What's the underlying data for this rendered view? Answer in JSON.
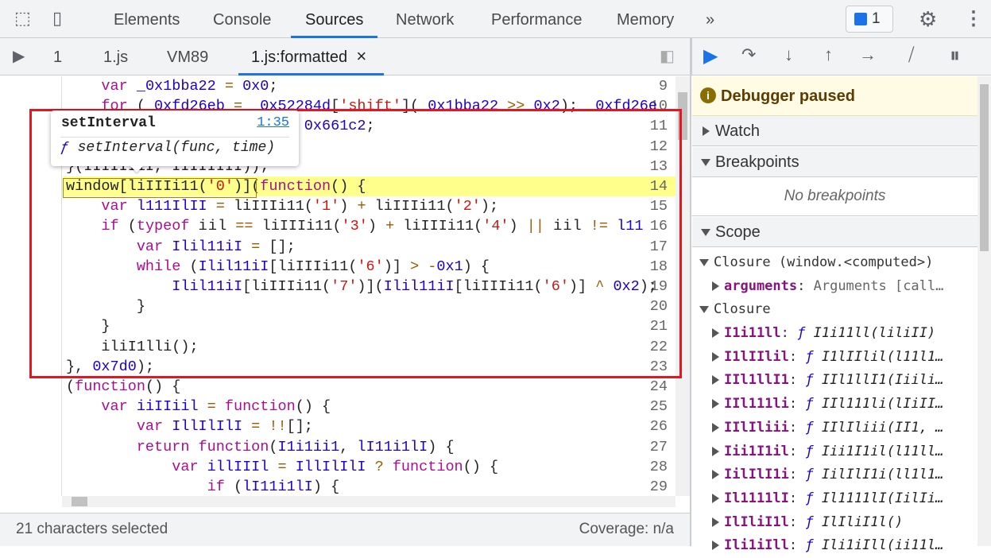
{
  "toolbar": {
    "tabs": [
      "Elements",
      "Console",
      "Sources",
      "Network",
      "Performance",
      "Memory"
    ],
    "active_tab": "Sources",
    "more": "»",
    "issues_count": "1",
    "icons": [
      "inspect-icon",
      "device-toggle-icon",
      "issues-icon",
      "gear-icon",
      "kebab-menu-icon"
    ]
  },
  "files": {
    "tabs": [
      "1",
      "1.js",
      "VM89",
      "1.js:formatted"
    ],
    "active": "1.js:formatted",
    "close": "×"
  },
  "debugger": {
    "paused_label": "Debugger paused",
    "icons": [
      "resume-icon",
      "step-over-icon",
      "step-into-icon",
      "step-out-icon",
      "step-icon",
      "deactivate-breakpoints-icon",
      "pause-on-exceptions-icon"
    ],
    "watch": "Watch",
    "breakpoints": "Breakpoints",
    "no_breakpoints": "No breakpoints",
    "scope": "Scope",
    "closure1": "Closure (window.<computed>)",
    "arguments": {
      "name": "arguments",
      "value": "Arguments [call…"
    },
    "closure2": "Closure",
    "scope_items": [
      {
        "name": "I1i11ll",
        "value": "I1i11ll(liliII)"
      },
      {
        "name": "I1lIIlil",
        "value": "I1lIIlil(l11l1…"
      },
      {
        "name": "IIl1llI1",
        "value": "IIl1llI1(Iiili…"
      },
      {
        "name": "IIl111li",
        "value": "IIl111li(lIiII…"
      },
      {
        "name": "IIlIliii",
        "value": "IIlIliii(II1, …"
      },
      {
        "name": "Iii1I1il",
        "value": "Iii1I1il(l11ll…"
      },
      {
        "name": "IilIlI1i",
        "value": "IilIlI1i(ll1l1…"
      },
      {
        "name": "Il1111lI",
        "value": "Il1111lI(IilIi…"
      },
      {
        "name": "IlIliI1l",
        "value": "IlIliI1l()"
      },
      {
        "name": "Ili1iIll",
        "value": "Ili1iIll(ii11l…"
      }
    ],
    "f": "ƒ"
  },
  "tooltip": {
    "title": "setInterval",
    "location": "1:35",
    "f": "ƒ",
    "signature": "setInterval(func, time)"
  },
  "editor": {
    "first_line": 9,
    "highlight_line": 14,
    "lines": [
      [
        [
          "x",
          "    "
        ],
        [
          "k",
          "var "
        ],
        [
          "v",
          "_0x1bba22"
        ],
        [
          "o",
          " = "
        ],
        [
          "n",
          "0x0"
        ],
        [
          "p",
          ";"
        ]
      ],
      [
        [
          "x",
          "    "
        ],
        [
          "k",
          "for "
        ],
        [
          "p",
          "("
        ],
        [
          "v",
          "_0xfd26eb"
        ],
        [
          "o",
          " = "
        ],
        [
          "v",
          "_0x52284d"
        ],
        [
          "p",
          "["
        ],
        [
          "s",
          "'shift'"
        ],
        [
          "p",
          "]("
        ],
        [
          "v",
          "_0x1bba22"
        ],
        [
          "o",
          " >> "
        ],
        [
          "n",
          "0x2"
        ],
        [
          "p",
          "); "
        ],
        [
          "v",
          "_0xfd26e"
        ]
      ],
      [
        [
          "x",
          "                    "
        ],
        [
          "v",
          "ba22"
        ],
        [
          "o",
          " ^ "
        ],
        [
          "n",
          "0x661c2"
        ],
        [
          "p",
          ";"
        ]
      ],
      [],
      [
        [
          "p",
          "}("
        ],
        [
          "x",
          "IIIIII1I, IIIIIIII"
        ],
        [
          "p",
          "));"
        ]
      ],
      [
        [
          "x",
          "window"
        ],
        [
          "p",
          "["
        ],
        [
          "x",
          "liIIIi11"
        ],
        [
          "p",
          "("
        ],
        [
          "s",
          "'0'"
        ],
        [
          "p",
          ")]("
        ],
        [
          "k",
          "function"
        ],
        [
          "p",
          "() {"
        ]
      ],
      [
        [
          "x",
          "    "
        ],
        [
          "k",
          "var "
        ],
        [
          "v",
          "l111IlII"
        ],
        [
          "o",
          " = "
        ],
        [
          "x",
          "liIIIi11"
        ],
        [
          "p",
          "("
        ],
        [
          "s",
          "'1'"
        ],
        [
          "p",
          ")"
        ],
        [
          "o",
          " + "
        ],
        [
          "x",
          "liIIIi11"
        ],
        [
          "p",
          "("
        ],
        [
          "s",
          "'2'"
        ],
        [
          "p",
          ");"
        ]
      ],
      [
        [
          "x",
          "    "
        ],
        [
          "k",
          "if "
        ],
        [
          "p",
          "("
        ],
        [
          "k",
          "typeof "
        ],
        [
          "x",
          "i i l"
        ],
        [
          "o",
          " == "
        ],
        [
          "x",
          "liIIIi11"
        ],
        [
          "p",
          "("
        ],
        [
          "s",
          "'3'"
        ],
        [
          "p",
          ")"
        ],
        [
          "o",
          " + "
        ],
        [
          "x",
          "liIIIi11"
        ],
        [
          "p",
          "("
        ],
        [
          "s",
          "'4'"
        ],
        [
          "p",
          ")"
        ],
        [
          "o",
          " || "
        ],
        [
          "x",
          "i i l"
        ],
        [
          "o",
          " != "
        ],
        [
          "v",
          "l11"
        ]
      ],
      [
        [
          "x",
          "        "
        ],
        [
          "k",
          "var "
        ],
        [
          "v",
          "Ilil11iI"
        ],
        [
          "o",
          " = "
        ],
        [
          "p",
          "[];"
        ]
      ],
      [
        [
          "x",
          "        "
        ],
        [
          "k",
          "while "
        ],
        [
          "p",
          "("
        ],
        [
          "v",
          "Ilil11iI"
        ],
        [
          "p",
          "["
        ],
        [
          "x",
          "liIIIi11"
        ],
        [
          "p",
          "("
        ],
        [
          "s",
          "'6'"
        ],
        [
          "p",
          ")]"
        ],
        [
          "o",
          " > -"
        ],
        [
          "n",
          "0x1"
        ],
        [
          "p",
          ") {"
        ]
      ],
      [
        [
          "x",
          "            "
        ],
        [
          "v",
          "Ilil11iI"
        ],
        [
          "p",
          "["
        ],
        [
          "x",
          "liIIIi11"
        ],
        [
          "p",
          "("
        ],
        [
          "s",
          "'7'"
        ],
        [
          "p",
          ")]("
        ],
        [
          "v",
          "Ilil11iI"
        ],
        [
          "p",
          "["
        ],
        [
          "x",
          "liIIIi11"
        ],
        [
          "p",
          "("
        ],
        [
          "s",
          "'6'"
        ],
        [
          "p",
          ")]"
        ],
        [
          "o",
          " ^ "
        ],
        [
          "n",
          "0x2"
        ],
        [
          "p",
          ");"
        ]
      ],
      [
        [
          "x",
          "        "
        ],
        [
          "p",
          "}"
        ]
      ],
      [
        [
          "x",
          "    "
        ],
        [
          "p",
          "}"
        ]
      ],
      [
        [
          "x",
          "    iliI1lli"
        ],
        [
          "p",
          "();"
        ]
      ],
      [
        [
          "p",
          "}, "
        ],
        [
          "n",
          "0x7d0"
        ],
        [
          "p",
          ");"
        ]
      ],
      [
        [
          "p",
          "("
        ],
        [
          "k",
          "function"
        ],
        [
          "p",
          "() {"
        ]
      ],
      [
        [
          "x",
          "    "
        ],
        [
          "k",
          "var "
        ],
        [
          "v",
          "iiIIiil"
        ],
        [
          "o",
          " = "
        ],
        [
          "k",
          "function"
        ],
        [
          "p",
          "() {"
        ]
      ],
      [
        [
          "x",
          "        "
        ],
        [
          "k",
          "var "
        ],
        [
          "v",
          "IllIlIlI"
        ],
        [
          "o",
          " = !!"
        ],
        [
          "p",
          "[];"
        ]
      ],
      [
        [
          "x",
          "        "
        ],
        [
          "k",
          "return function"
        ],
        [
          "p",
          "("
        ],
        [
          "v",
          "I1i1ii1"
        ],
        [
          "p",
          ", "
        ],
        [
          "v",
          "lI11i1lI"
        ],
        [
          "p",
          ") {"
        ]
      ],
      [
        [
          "x",
          "            "
        ],
        [
          "k",
          "var "
        ],
        [
          "v",
          "illIIIl"
        ],
        [
          "o",
          " = "
        ],
        [
          "v",
          "IllIlIlI"
        ],
        [
          "o",
          " ? "
        ],
        [
          "k",
          "function"
        ],
        [
          "p",
          "() {"
        ]
      ],
      [
        [
          "x",
          "                "
        ],
        [
          "k",
          "if "
        ],
        [
          "p",
          "("
        ],
        [
          "v",
          "lI11i1lI"
        ],
        [
          "p",
          ") {"
        ]
      ],
      []
    ]
  },
  "status": {
    "selection": "21 characters selected",
    "coverage": "Coverage: n/a"
  }
}
